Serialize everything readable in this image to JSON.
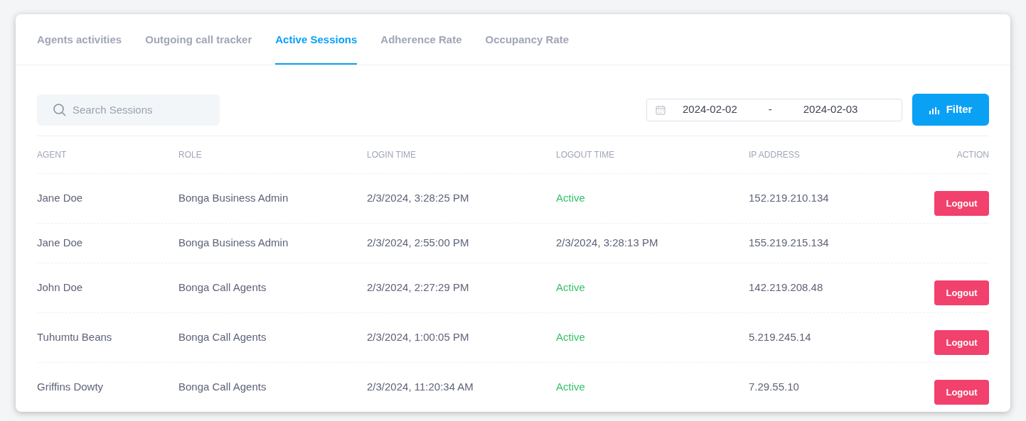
{
  "tabs": [
    {
      "label": "Agents activities",
      "selected": false
    },
    {
      "label": "Outgoing call tracker",
      "selected": false
    },
    {
      "label": "Active Sessions",
      "selected": true
    },
    {
      "label": "Adherence Rate",
      "selected": false
    },
    {
      "label": "Occupancy Rate",
      "selected": false
    }
  ],
  "search": {
    "placeholder": "Search Sessions"
  },
  "date_range": {
    "start": "2024-02-02",
    "separator": "-",
    "end": "2024-02-03"
  },
  "filter_button": "Filter",
  "table": {
    "columns": [
      "AGENT",
      "ROLE",
      "LOGIN TIME",
      "LOGOUT TIME",
      "IP ADDRESS",
      "ACTION"
    ],
    "rows": [
      {
        "agent": "Jane Doe",
        "role": "Bonga Business Admin",
        "login_time": "2/3/2024, 3:28:25 PM",
        "logout_time": "Active",
        "kind": "active",
        "ip_address": "152.219.210.134",
        "action": "Logout"
      },
      {
        "agent": "Jane Doe",
        "role": "Bonga Business Admin",
        "login_time": "2/3/2024, 2:55:00 PM",
        "logout_time": "2/3/2024, 3:28:13 PM",
        "kind": "time",
        "ip_address": "155.219.215.134"
      },
      {
        "agent": "John Doe",
        "role": "Bonga Call Agents",
        "login_time": "2/3/2024, 2:27:29 PM",
        "logout_time": "Active",
        "kind": "active",
        "ip_address": "142.219.208.48",
        "action": "Logout"
      },
      {
        "agent": "Tuhumtu Beans",
        "role": "Bonga Call Agents",
        "login_time": "2/3/2024, 1:00:05 PM",
        "logout_time": "Active",
        "kind": "active",
        "ip_address": "5.219.245.14",
        "action": "Logout"
      },
      {
        "agent": "Griffins Dowty",
        "role": "Bonga Call Agents",
        "login_time": "2/3/2024, 11:20:34 AM",
        "logout_time": "Active",
        "kind": "active",
        "ip_address": "7.29.55.10",
        "action": "Logout"
      }
    ]
  }
}
